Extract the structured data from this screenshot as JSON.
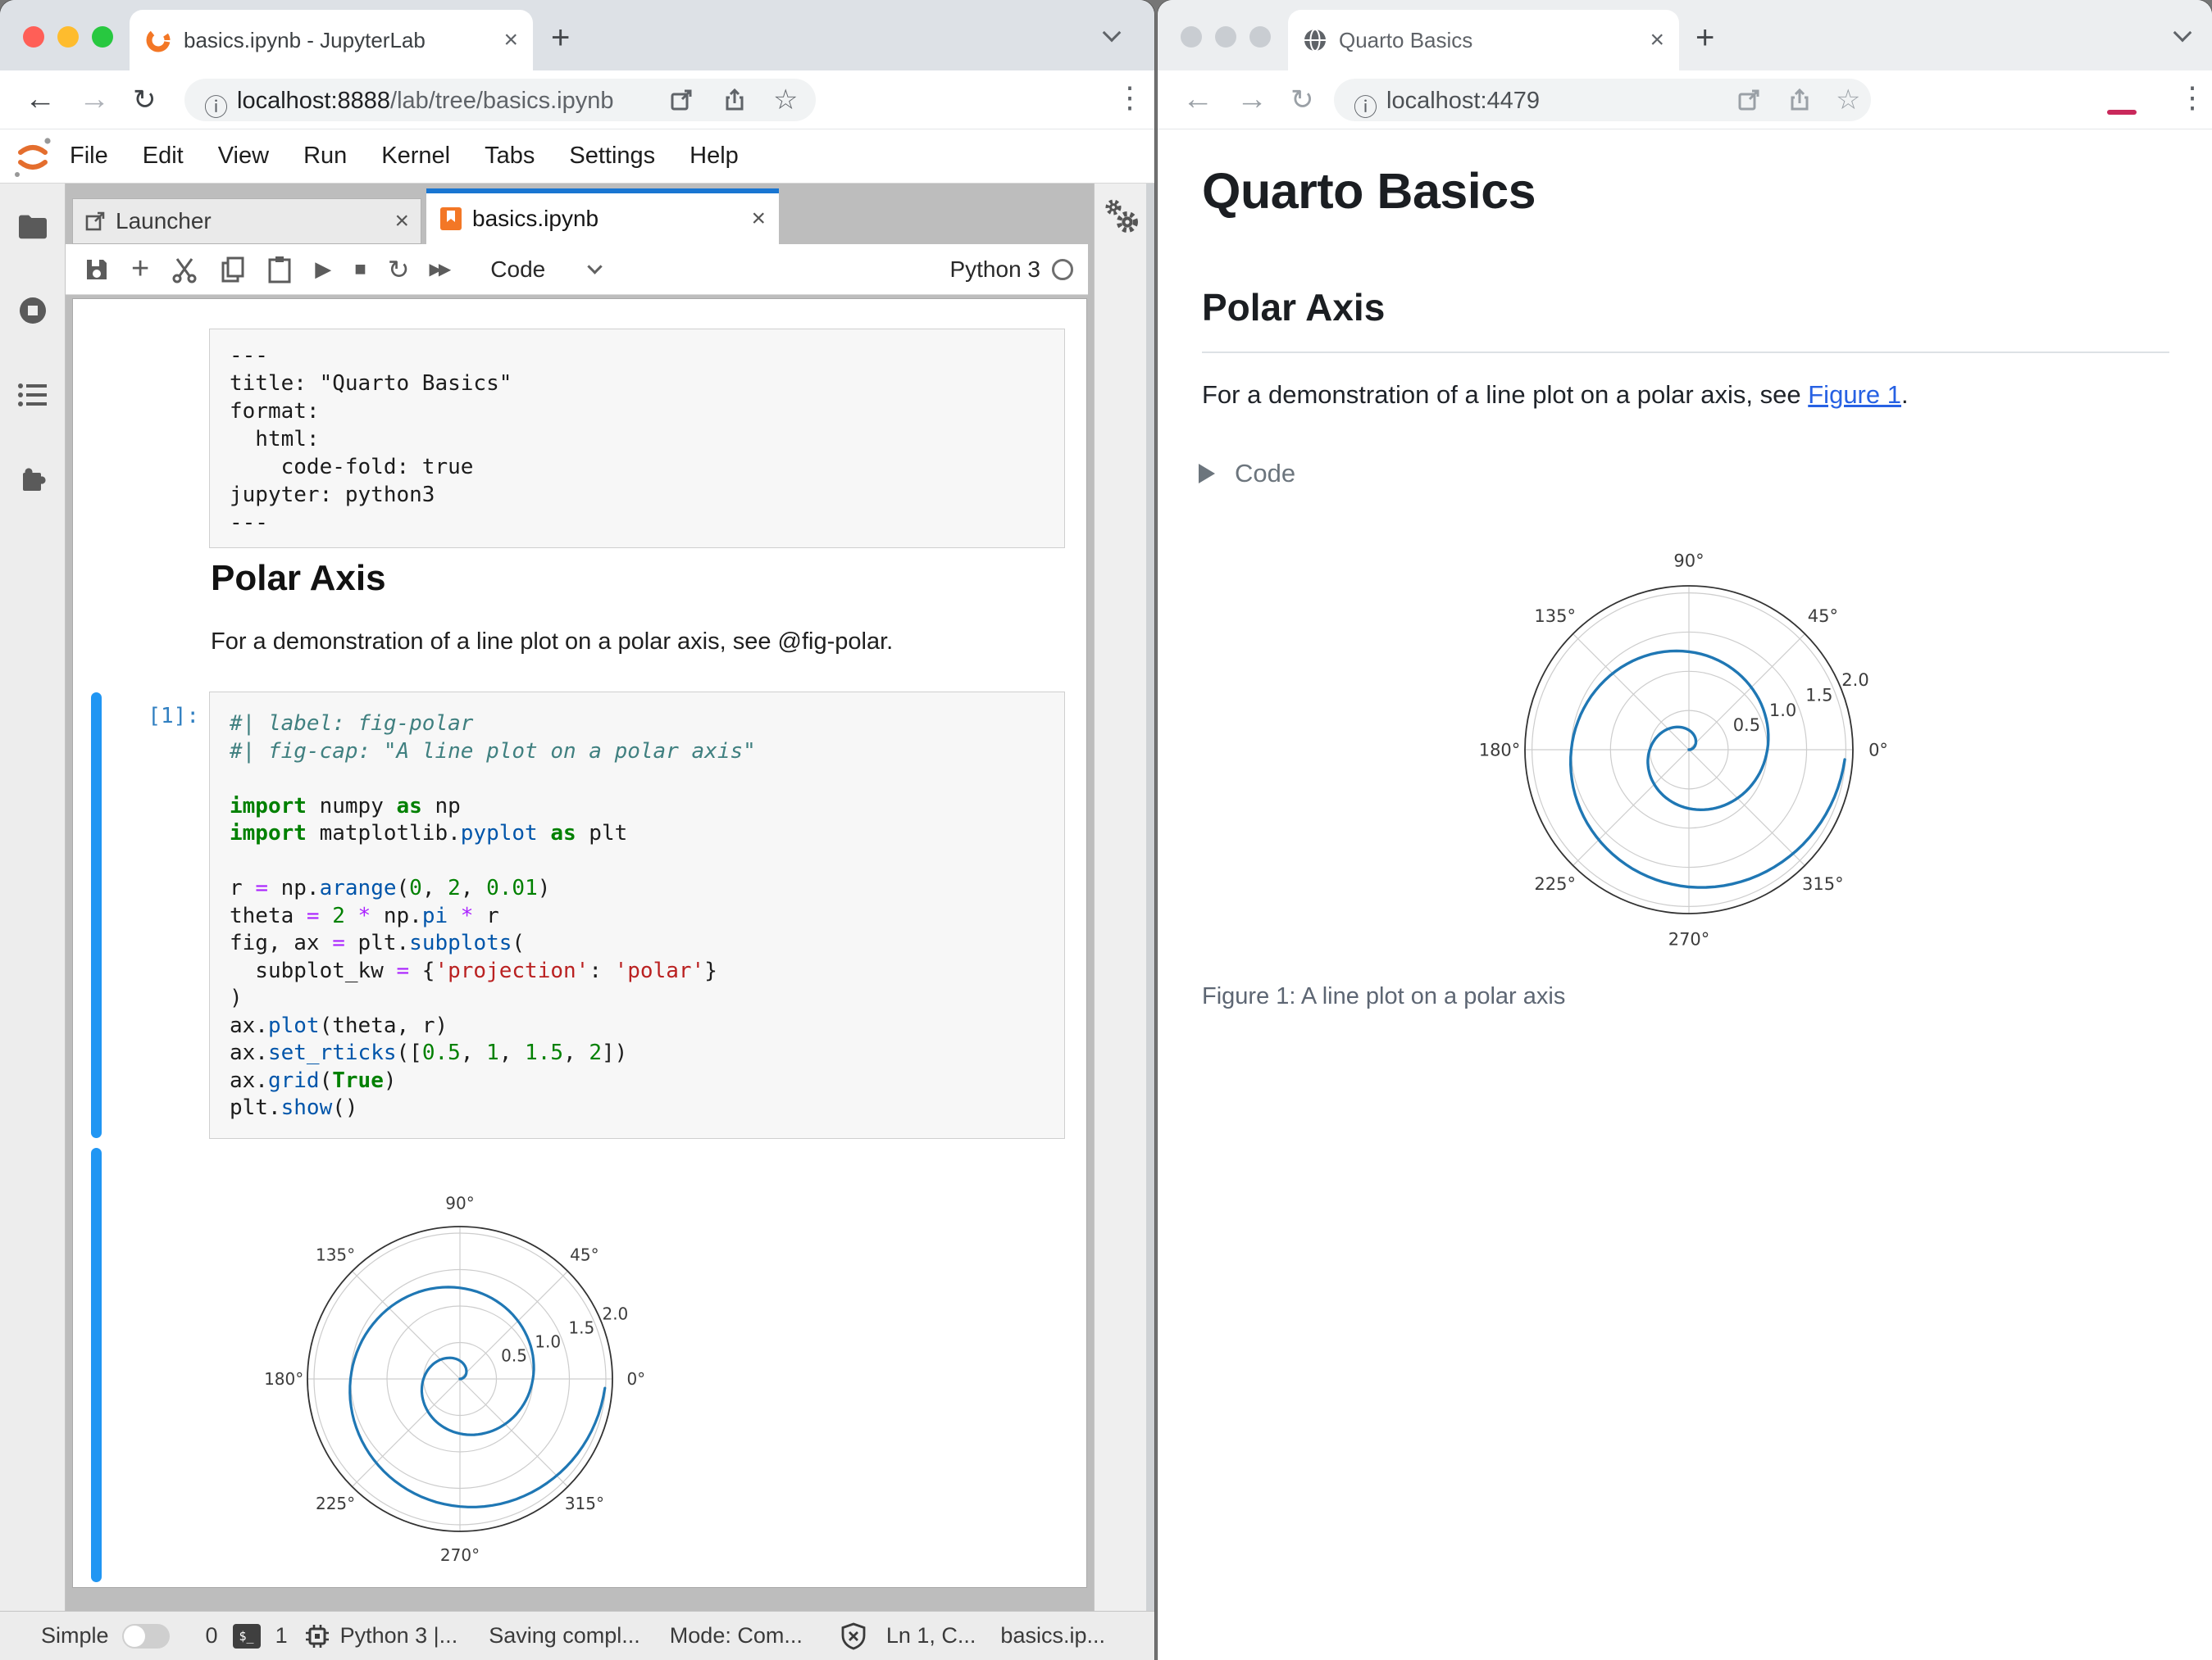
{
  "chart_data": {
    "type": "line",
    "projection": "polar",
    "title": "",
    "series": [
      {
        "name": "spiral",
        "definition": "theta = 2*pi*r",
        "r_min": 0,
        "r_max_value": 1.99,
        "r_step": 0.01
      }
    ],
    "radial_ticks": [
      0.5,
      1.0,
      1.5,
      2.0
    ],
    "radial_tick_labels": [
      "0.5",
      "1.0",
      "1.5",
      "2.0"
    ],
    "angular_ticks_deg": [
      0,
      45,
      90,
      135,
      180,
      225,
      270,
      315
    ],
    "angular_tick_labels": [
      "0°",
      "45°",
      "90°",
      "135°",
      "180°",
      "225°",
      "270°",
      "315°"
    ],
    "rlim": [
      0,
      2.09
    ],
    "rlabel_angle_deg": 22.5,
    "grid": true,
    "line_color": "#1f77b4"
  },
  "colors": {
    "accent_blue": "#1976d2",
    "jupyter_orange": "#f37726",
    "link_blue": "#2761e3",
    "cell_bar_blue": "#2196f3",
    "plot_line": "#1f77b4"
  },
  "left": {
    "tab_title": "basics.ipynb - JupyterLab",
    "url_host": "localhost:8888",
    "url_path": "/lab/tree/basics.ipynb",
    "menu": [
      "File",
      "Edit",
      "View",
      "Run",
      "Kernel",
      "Tabs",
      "Settings",
      "Help"
    ],
    "doc_tabs": {
      "launcher": "Launcher",
      "notebook": "basics.ipynb"
    },
    "toolbar": {
      "cell_type": "Code",
      "kernel_name": "Python 3"
    },
    "yaml_lines": [
      "---",
      "title: \"Quarto Basics\"",
      "format:",
      "  html:",
      "    code-fold: true",
      "jupyter: python3",
      "---"
    ],
    "markdown": {
      "heading": "Polar Axis",
      "paragraph": "For a demonstration of a line plot on a polar axis, see @fig-polar."
    },
    "code": {
      "prompt": "[1]:",
      "lines": [
        [
          [
            "c",
            "#| label: fig-polar"
          ]
        ],
        [
          [
            "c",
            "#| fig-cap: \"A line plot on a polar axis\""
          ]
        ],
        [],
        [
          [
            "k",
            "import"
          ],
          [
            "w",
            " numpy "
          ],
          [
            "k",
            "as"
          ],
          [
            "w",
            " np"
          ]
        ],
        [
          [
            "k",
            "import"
          ],
          [
            "w",
            " matplotlib."
          ],
          [
            "p",
            "pyplot"
          ],
          [
            "w",
            " "
          ],
          [
            "k",
            "as"
          ],
          [
            "w",
            " plt"
          ]
        ],
        [],
        [
          [
            "w",
            "r "
          ],
          [
            "o",
            "="
          ],
          [
            "w",
            " np."
          ],
          [
            "p",
            "arange"
          ],
          [
            "w",
            "("
          ],
          [
            "m",
            "0"
          ],
          [
            "w",
            ", "
          ],
          [
            "m",
            "2"
          ],
          [
            "w",
            ", "
          ],
          [
            "m",
            "0.01"
          ],
          [
            "w",
            ")"
          ]
        ],
        [
          [
            "w",
            "theta "
          ],
          [
            "o",
            "="
          ],
          [
            "w",
            " "
          ],
          [
            "m",
            "2"
          ],
          [
            "w",
            " "
          ],
          [
            "o",
            "*"
          ],
          [
            "w",
            " np."
          ],
          [
            "p",
            "pi"
          ],
          [
            "w",
            " "
          ],
          [
            "o",
            "*"
          ],
          [
            "w",
            " r"
          ]
        ],
        [
          [
            "w",
            "fig, ax "
          ],
          [
            "o",
            "="
          ],
          [
            "w",
            " plt."
          ],
          [
            "p",
            "subplots"
          ],
          [
            "w",
            "("
          ]
        ],
        [
          [
            "w",
            "  subplot_kw "
          ],
          [
            "o",
            "="
          ],
          [
            "w",
            " {"
          ],
          [
            "s",
            "'projection'"
          ],
          [
            "w",
            ": "
          ],
          [
            "s",
            "'polar'"
          ],
          [
            "w",
            "}"
          ]
        ],
        [
          [
            "w",
            ")"
          ]
        ],
        [
          [
            "w",
            "ax."
          ],
          [
            "p",
            "plot"
          ],
          [
            "w",
            "(theta, r)"
          ]
        ],
        [
          [
            "w",
            "ax."
          ],
          [
            "p",
            "set_rticks"
          ],
          [
            "w",
            "(["
          ],
          [
            "m",
            "0.5"
          ],
          [
            "w",
            ", "
          ],
          [
            "m",
            "1"
          ],
          [
            "w",
            ", "
          ],
          [
            "m",
            "1.5"
          ],
          [
            "w",
            ", "
          ],
          [
            "m",
            "2"
          ],
          [
            "w",
            "])"
          ]
        ],
        [
          [
            "w",
            "ax."
          ],
          [
            "p",
            "grid"
          ],
          [
            "w",
            "("
          ],
          [
            "k",
            "True"
          ],
          [
            "w",
            ")"
          ]
        ],
        [
          [
            "w",
            "plt."
          ],
          [
            "p",
            "show"
          ],
          [
            "w",
            "()"
          ]
        ]
      ]
    },
    "status": {
      "simple_label": "Simple",
      "terminal_count": "0",
      "kernel_count": "1",
      "kernel": "Python 3 |...",
      "saving": "Saving compl...",
      "mode": "Mode: Com...",
      "position": "Ln 1, C...",
      "file": "basics.ip..."
    }
  },
  "right": {
    "tab_title": "Quarto Basics",
    "url": "localhost:4479",
    "page": {
      "title": "Quarto Basics",
      "section_heading": "Polar Axis",
      "paragraph_before": "For a demonstration of a line plot on a polar axis, see ",
      "link_text": "Figure 1",
      "paragraph_after": ".",
      "code_toggle_label": "Code",
      "figure_caption": "Figure 1: A line plot on a polar axis"
    }
  }
}
